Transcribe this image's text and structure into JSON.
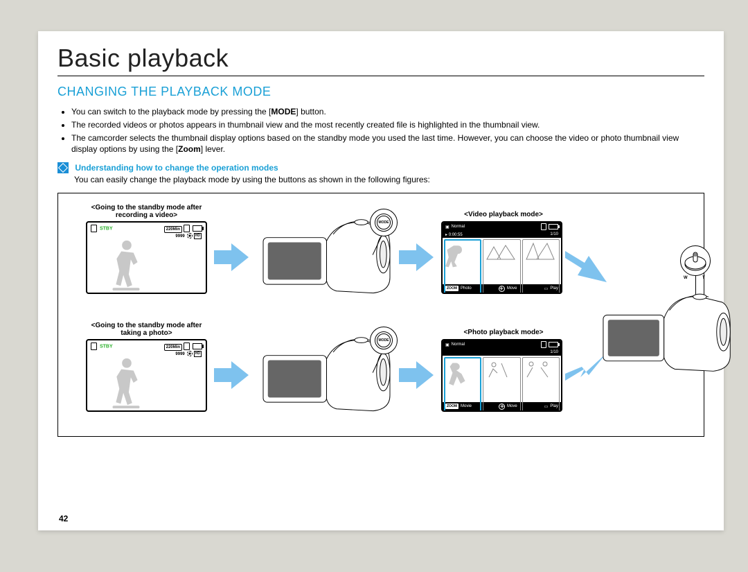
{
  "page_number": "42",
  "chapter_title": "Basic playback",
  "section_title": "CHANGING THE PLAYBACK MODE",
  "bullets": [
    {
      "pre": "You can switch to the playback mode by pressing the [",
      "bold": "MODE",
      "post": "] button."
    },
    {
      "pre": "The recorded videos or photos appears in thumbnail view and the most recently created file is highlighted in the thumbnail view.",
      "bold": "",
      "post": ""
    },
    {
      "pre": "The camcorder selects the thumbnail display options based on the standby mode you used the last time. However, you can choose the video or photo thumbnail view display options by using the [",
      "bold": "Zoom",
      "post": "] lever."
    }
  ],
  "info": {
    "icon": "tip-icon",
    "title": "Understanding how to change the operation modes",
    "body": "You can easily change the playback mode by using the buttons as shown in the following figures:"
  },
  "screens": {
    "standby_video": {
      "label": "<Going to the standby mode after recording a video>",
      "status": "STBY",
      "time": "220Min",
      "count": "9999",
      "hd": "HD"
    },
    "standby_photo": {
      "label": "<Going to the standby mode after taking a photo>",
      "status": "STBY",
      "time": "220Min",
      "count": "9999",
      "hd": "HD"
    },
    "video_pb": {
      "label": "<Video playback mode>",
      "normal": "Normal",
      "elapsed": "0:00:55",
      "page": "1/10",
      "footer_l": "Photo",
      "footer_m": "Move",
      "footer_r": "Play",
      "zoom_tag": "ZOOM"
    },
    "photo_pb": {
      "label": "<Photo playback mode>",
      "normal": "Normal",
      "page": "1/10",
      "footer_l": "Movie",
      "footer_m": "Move",
      "footer_r": "Play",
      "zoom_tag": "ZOOM"
    }
  },
  "callouts": {
    "mode_btn": "MODE",
    "zoom_w": "W",
    "zoom_t": "T"
  }
}
